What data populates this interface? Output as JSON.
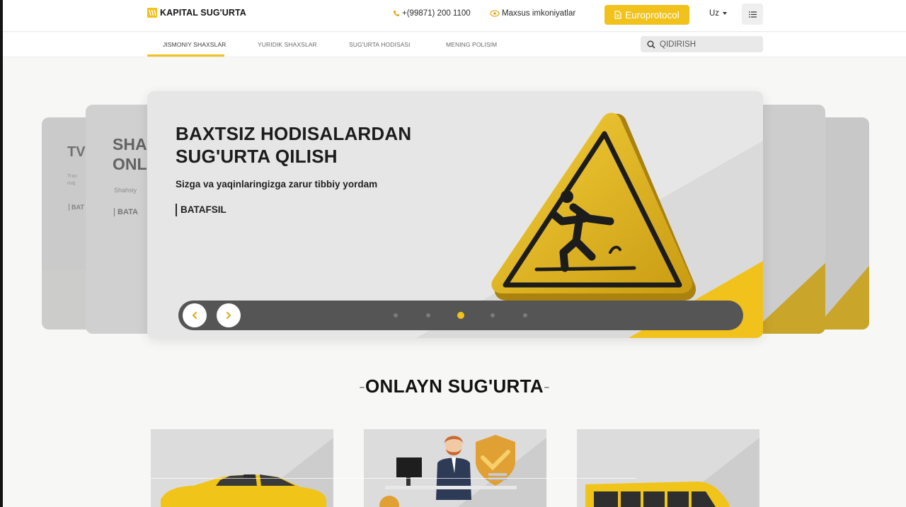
{
  "header": {
    "brand": "KAPITAL SUG'URTA",
    "phone": "+(99871) 200 1100",
    "accessibility": "Maxsus imkoniyatlar",
    "europrotocol": "Europrotocol",
    "language": "Uz"
  },
  "nav": {
    "items": [
      {
        "label": "JISMONIY SHAXSLAR"
      },
      {
        "label": "YURIDIK SHAXSLAR"
      },
      {
        "label": "SUG'URTA HODISASI"
      },
      {
        "label": "MENING POLISIM"
      }
    ],
    "search_placeholder": "QIDIRISH"
  },
  "carousel": {
    "title_line1": "BAXTSIZ HODISALARDAN",
    "title_line2": "SUG'URTA QILISH",
    "subtitle": "Sizga va yaqinlaringizga zarur tibbiy yordam",
    "more": "BATAFSIL",
    "prev_icon": "chevron-left-icon",
    "next_icon": "chevron-right-icon",
    "dot_count": 5,
    "active_dot": 3,
    "ghost_left_2": {
      "title": "TV",
      "line1": "Tran",
      "line2": "maj",
      "more": "BAT"
    },
    "ghost_left_1": {
      "title_line1": "SHA",
      "title_line2": "ONL",
      "line1": "Shahsiy",
      "more": "BATA"
    }
  },
  "section": {
    "title": "ONLAYN SUG'URTA"
  },
  "colors": {
    "accent": "#f1c21b",
    "dark": "#1c1c1c",
    "control_bar": "#555555"
  }
}
